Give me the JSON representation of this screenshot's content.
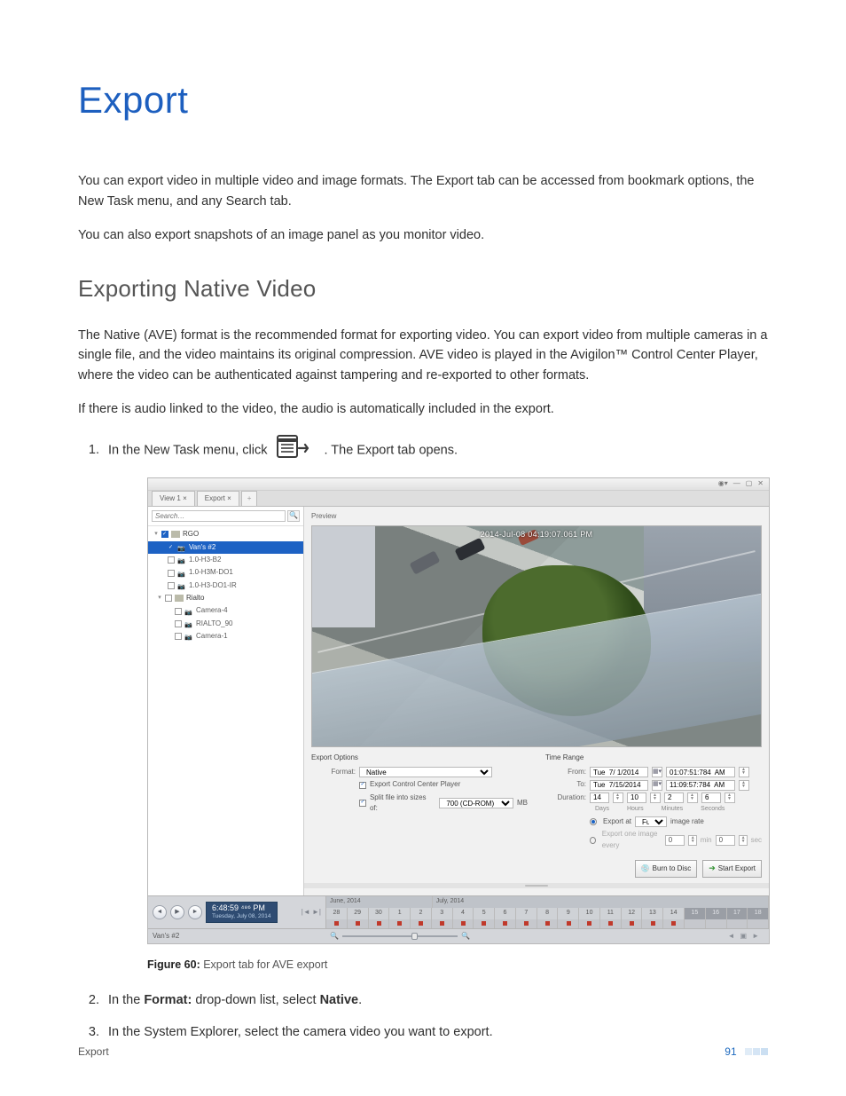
{
  "page": {
    "title": "Export",
    "intro1": "You can export video in multiple video and image formats. The Export tab can be accessed from bookmark options, the New Task menu, and any Search tab.",
    "intro2": "You can also export snapshots of an image panel as you monitor video.",
    "h2": "Exporting Native Video",
    "p1": "The Native (AVE) format is the recommended format for exporting video. You can export video from multiple cameras in a single file, and the video maintains its original compression. AVE video is played in the Avigilon™ Control Center Player, where the video can be authenticated against tampering and re-exported to other formats.",
    "p2": "If there is audio linked to the video, the audio is automatically included in the export.",
    "step1_a": "In the New Task menu, click",
    "step1_b": ". The Export tab opens.",
    "caption_label": "Figure 60:",
    "caption_text": " Export tab for AVE export",
    "step2_a": "In the ",
    "step2_b": "Format:",
    "step2_c": " drop-down list, select ",
    "step2_d": "Native",
    "step2_e": ".",
    "step3": "In the System Explorer, select the camera video you want to export.",
    "footer_left": "Export",
    "page_number": "91"
  },
  "shot": {
    "tabs": {
      "view": "View 1 ×",
      "export": "Export ×",
      "add": "+"
    },
    "window_ctrls": {
      "menu": "◉▾",
      "min": "—",
      "max": "▢",
      "close": "✕"
    },
    "search_placeholder": "Search…",
    "tree": {
      "site1": "RGO",
      "cam_sel": "Van's #2",
      "cam_a": "1.0-H3-B2",
      "cam_b": "1.0-H3M-DO1",
      "cam_c": "1.0-H3-DO1-IR",
      "site2": "Rialto",
      "cam_d": "Camera-4",
      "cam_e": "RIALTO_90",
      "cam_f": "Camera-1"
    },
    "preview_label": "Preview",
    "timestamp_overlay": "2014-Jul-08 04:19:07.061 PM",
    "export_options": {
      "heading": "Export Options",
      "format_label": "Format:",
      "format_value": "Native",
      "opt1": "Export Control Center Player",
      "opt2_a": "Split file into sizes of:",
      "opt2_val": "700 (CD-ROM)",
      "opt2_unit": "MB"
    },
    "time_range": {
      "heading": "Time Range",
      "from_label": "From:",
      "from_date": "Tue  7/ 1/2014",
      "from_time": "01:07:51:784  AM",
      "to_label": "To:",
      "to_date": "Tue  7/15/2014",
      "to_time": "11:09:57:784  AM",
      "dur_label": "Duration:",
      "dur_days": "14",
      "dur_hours": "10",
      "dur_min": "2",
      "dur_sec": "6",
      "dur_h_days": "Days",
      "dur_h_hours": "Hours",
      "dur_h_min": "Minutes",
      "dur_h_sec": "Seconds",
      "rate_a": "Export at",
      "rate_sel": "Full",
      "rate_b": "image rate",
      "every_a": "Export one image every",
      "every_v1": "0",
      "every_u1": "min",
      "every_v2": "0",
      "every_u2": "sec"
    },
    "buttons": {
      "burn": "Burn to Disc",
      "start": "Start Export"
    },
    "timeline": {
      "play_time": "6:48:59 ⁴⁸⁶ PM",
      "play_date": "Tuesday, July 08, 2014",
      "month_a": "June, 2014",
      "month_b": "July, 2014",
      "days_a": [
        "28",
        "29",
        "30",
        "1",
        "2",
        "3",
        "4",
        "5",
        "6",
        "7",
        "8"
      ],
      "days_b": [
        "9",
        "10",
        "11",
        "12",
        "13",
        "14"
      ],
      "days_fut": [
        "15",
        "16",
        "17",
        "18"
      ],
      "cam_name": "Van's #2"
    }
  }
}
